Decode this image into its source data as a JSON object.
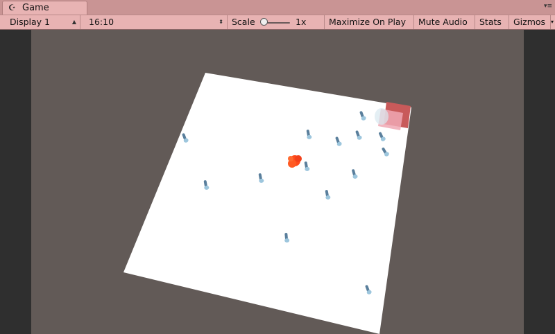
{
  "tab": {
    "title": "Game",
    "icon": "game-icon"
  },
  "toolbar": {
    "display": "Display 1",
    "aspect": "16:10",
    "scale_label": "Scale",
    "scale_value": "1x",
    "maximize": "Maximize On Play",
    "mute": "Mute Audio",
    "stats": "Stats",
    "gizmos": "Gizmos"
  },
  "colors": {
    "chrome": "#e8b3b3",
    "viewport_bg": "#625a57",
    "ground": "#ffffff",
    "target": "#ff4a1a",
    "goal": "#e06060",
    "agent": "#5a7f9c"
  }
}
